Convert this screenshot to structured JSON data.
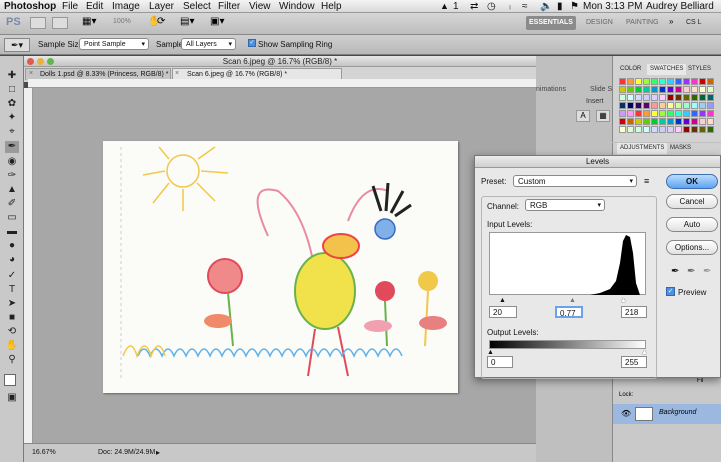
{
  "menubar": {
    "app": "Photoshop",
    "menus": [
      "File",
      "Edit",
      "Image",
      "Layer",
      "Select",
      "Filter",
      "View",
      "Window",
      "Help"
    ],
    "ai_badge": "1",
    "clock": "Mon 3:13 PM",
    "user": "Audrey Belliard"
  },
  "appbar": {
    "ps_logo": "PS",
    "zoom": "100%",
    "workspaces": [
      "ESSENTIALS",
      "DESIGN",
      "PAINTING"
    ],
    "cs_live": "CS L"
  },
  "options": {
    "sample_size_label": "Sample Size:",
    "sample_size_value": "Point Sample",
    "sample_label": "Sample:",
    "sample_value": "All Layers",
    "sampling_ring_label": "Show Sampling Ring"
  },
  "document": {
    "window_title": "Scan 6.jpeg @ 16.7% (RGB/8) *",
    "tabs": [
      "Dolls 1.psd @ 8.33% (Princess, RGB/8) *",
      "Scan 6.jpeg @ 16.7% (RGB/8) *"
    ],
    "zoom": "16.67%",
    "doc_info": "Doc: 24.9M/24.9M"
  },
  "side_panels": {
    "animations_label": "nimations",
    "slide_label": "Slide Sh",
    "insert_label": "Insert",
    "tabs_top": [
      "COLOR",
      "SWATCHES",
      "STYLES"
    ],
    "tabs_mid": [
      "ADJUSTMENTS",
      "MASKS"
    ],
    "layer_name": "Background",
    "lock_label": "Lock:",
    "fill_label": "Fil"
  },
  "levels": {
    "title": "Levels",
    "preset_label": "Preset:",
    "preset_value": "Custom",
    "channel_label": "Channel:",
    "channel_value": "RGB",
    "input_levels_label": "Input Levels:",
    "input_black": "20",
    "input_gamma": "0.77",
    "input_white": "218",
    "output_levels_label": "Output Levels:",
    "output_black": "0",
    "output_white": "255",
    "ok": "OK",
    "cancel": "Cancel",
    "auto": "Auto",
    "options": "Options...",
    "preview": "Preview"
  },
  "colors": {
    "accent": "#5ea4f0",
    "selected_tab": "#e6e6e6"
  }
}
